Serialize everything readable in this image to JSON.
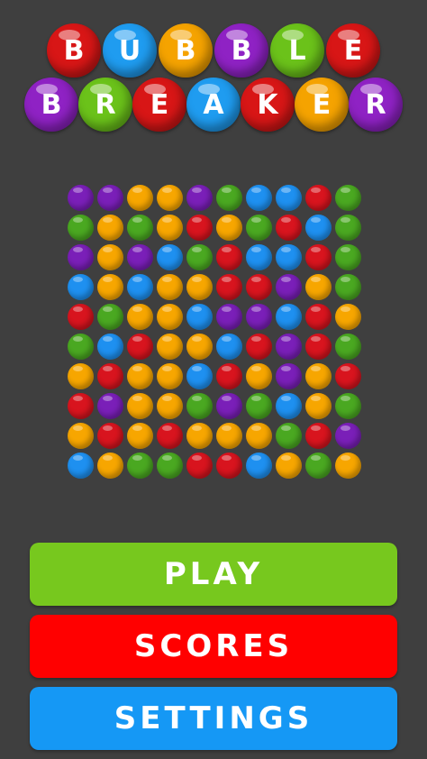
{
  "title": {
    "row1": [
      {
        "letter": "B",
        "color": "#d81616"
      },
      {
        "letter": "U",
        "color": "#1f9cf0"
      },
      {
        "letter": "B",
        "color": "#f5a300"
      },
      {
        "letter": "B",
        "color": "#8f22c4"
      },
      {
        "letter": "L",
        "color": "#6bc21a"
      },
      {
        "letter": "E",
        "color": "#d81616"
      }
    ],
    "row2": [
      {
        "letter": "B",
        "color": "#8f22c4"
      },
      {
        "letter": "R",
        "color": "#6bc21a"
      },
      {
        "letter": "E",
        "color": "#d81616"
      },
      {
        "letter": "A",
        "color": "#1f9cf0"
      },
      {
        "letter": "K",
        "color": "#d81616"
      },
      {
        "letter": "E",
        "color": "#f5a300"
      },
      {
        "letter": "R",
        "color": "#8f22c4"
      }
    ]
  },
  "colors": {
    "purple": "#7a1fb8",
    "orange": "#f7a600",
    "green": "#4aa821",
    "blue": "#1e90f0",
    "red": "#d8141e",
    "background": "#3f3f3f"
  },
  "board": [
    [
      "purple",
      "purple",
      "orange",
      "orange",
      "purple",
      "green",
      "blue",
      "blue",
      "red",
      "green"
    ],
    [
      "green",
      "orange",
      "green",
      "orange",
      "red",
      "orange",
      "green",
      "red",
      "blue",
      "green"
    ],
    [
      "purple",
      "orange",
      "purple",
      "blue",
      "green",
      "red",
      "blue",
      "blue",
      "red",
      "green"
    ],
    [
      "blue",
      "orange",
      "blue",
      "orange",
      "orange",
      "red",
      "red",
      "purple",
      "orange",
      "green"
    ],
    [
      "red",
      "green",
      "orange",
      "orange",
      "blue",
      "purple",
      "purple",
      "blue",
      "red",
      "orange"
    ],
    [
      "green",
      "blue",
      "red",
      "orange",
      "orange",
      "blue",
      "red",
      "purple",
      "red",
      "green"
    ],
    [
      "orange",
      "red",
      "orange",
      "orange",
      "blue",
      "red",
      "orange",
      "purple",
      "orange",
      "red"
    ],
    [
      "red",
      "purple",
      "orange",
      "orange",
      "green",
      "purple",
      "green",
      "blue",
      "orange",
      "green"
    ],
    [
      "orange",
      "red",
      "orange",
      "red",
      "orange",
      "orange",
      "orange",
      "green",
      "red",
      "purple"
    ],
    [
      "blue",
      "orange",
      "green",
      "green",
      "red",
      "red",
      "blue",
      "orange",
      "green",
      "orange"
    ]
  ],
  "menu": {
    "play": {
      "label": "PLAY",
      "color": "#77c81e"
    },
    "scores": {
      "label": "SCORES",
      "color": "#ff0000"
    },
    "settings": {
      "label": "SETTINGS",
      "color": "#1598f5"
    }
  }
}
